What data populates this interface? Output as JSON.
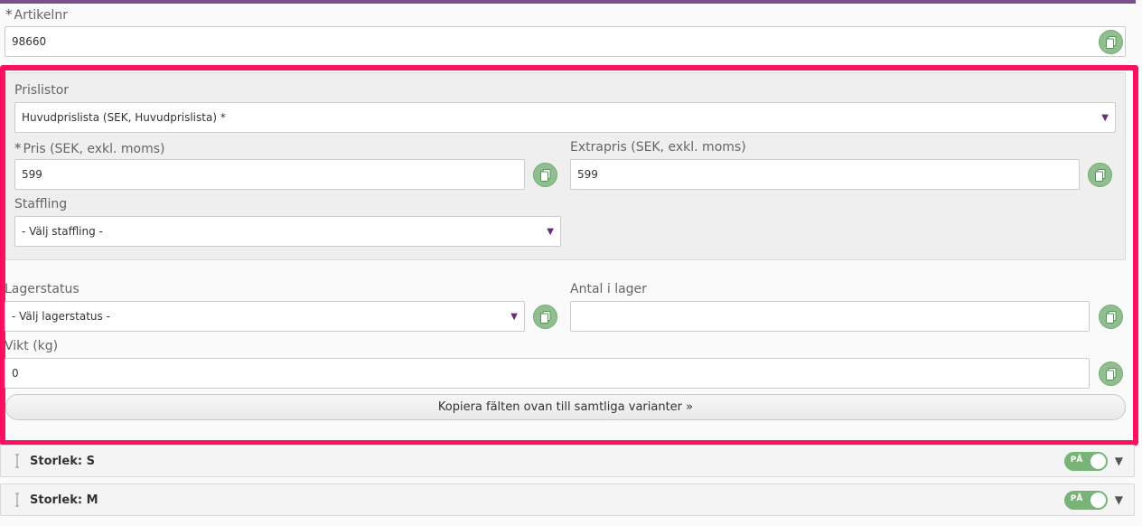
{
  "article": {
    "required_mark": "*",
    "label": "Artikelnr",
    "value": "98660"
  },
  "pricelists": {
    "label": "Prislistor",
    "selected": "Huvudprislista (SEK, Huvudprislista) *"
  },
  "price": {
    "required_mark": "*",
    "label": "Pris (SEK, exkl. moms)",
    "value": "599"
  },
  "extraprice": {
    "label": "Extrapris (SEK, exkl. moms)",
    "value": "599"
  },
  "tiering": {
    "label": "Staffling",
    "selected": "- Välj staffling -"
  },
  "stock_status": {
    "label": "Lagerstatus",
    "selected": "- Välj lagerstatus -"
  },
  "stock_qty": {
    "label": "Antal i lager",
    "value": ""
  },
  "weight": {
    "label": "Vikt (kg)",
    "value": "0"
  },
  "copy_all_label": "Kopiera fälten ovan till samtliga varianter »",
  "variants": [
    {
      "title": "Storlek: S",
      "toggle_label": "PÅ"
    },
    {
      "title": "Storlek: M",
      "toggle_label": "PÅ"
    }
  ],
  "colors": {
    "accent_purple": "#7a4e8c",
    "highlight": "#ff0f63",
    "copy_button": "#8fbf8f",
    "toggle_on": "#78b378"
  },
  "icons": {
    "copy": "copy-icon",
    "dropdown": "caret-down-icon",
    "drag": "drag-handle-icon",
    "expand": "chevron-down-icon"
  }
}
